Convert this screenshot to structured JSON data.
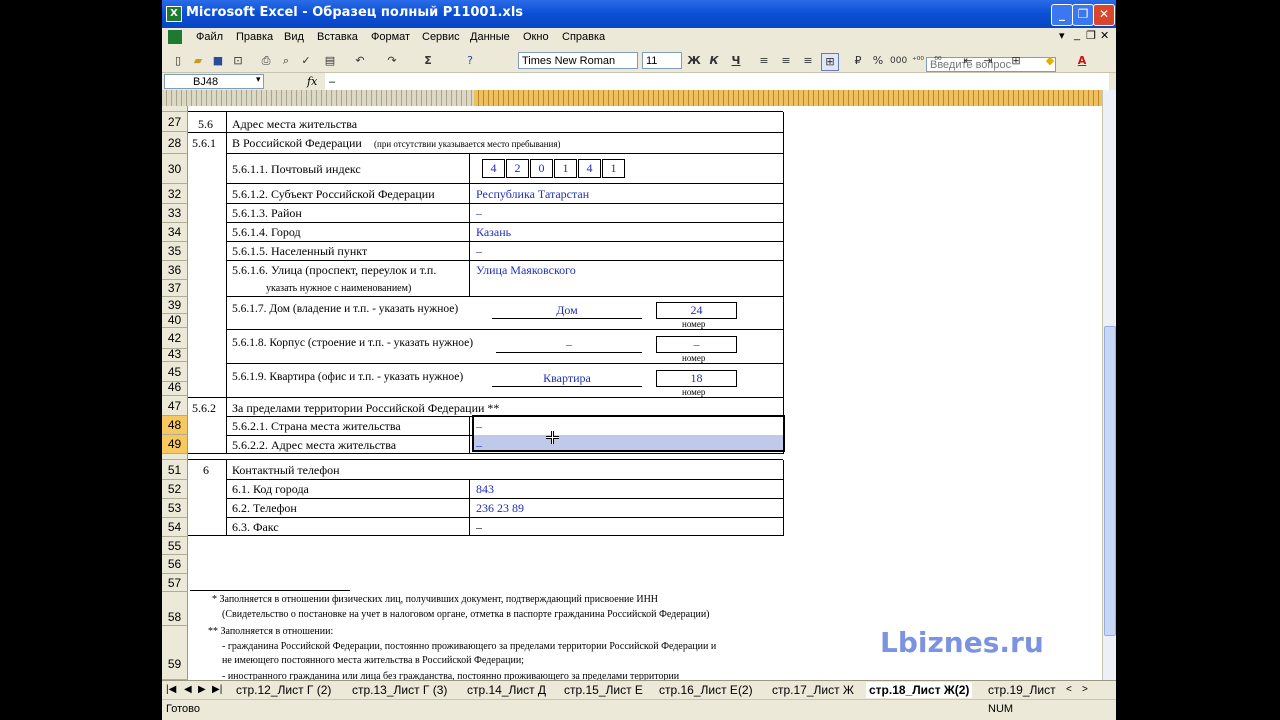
{
  "window": {
    "title": "Microsoft Excel - Образец полный Р11001.xls",
    "minimize": "_",
    "restore": "❐",
    "close": "✕"
  },
  "menu": [
    "Файл",
    "Правка",
    "Вид",
    "Вставка",
    "Формат",
    "Сервис",
    "Данные",
    "Окно",
    "Справка"
  ],
  "ask_placeholder": "Введите вопрос",
  "toolbar": {
    "font_name": "Times New Roman",
    "font_size": "11",
    "bold": "Ж",
    "italic": "К",
    "underline": "Ч",
    "sigma": "Σ",
    "percent": "%",
    "thousands": "000",
    "dec_inc": "⁺⁰⁰",
    "dec_dec": "⁰⁰",
    "font_color_letter": "A"
  },
  "formula_bar": {
    "name_box": "BJ48",
    "fx": "fx",
    "value": "–"
  },
  "rows": {
    "r27": "27",
    "r28": "28",
    "r30": "30",
    "r32": "32",
    "r33": "33",
    "r34": "34",
    "r35": "35",
    "r36": "36",
    "r37": "37",
    "r39": "39",
    "r40": "40",
    "r42": "42",
    "r43": "43",
    "r45": "45",
    "r46": "46",
    "r47": "47",
    "r48": "48",
    "r49": "49",
    "r51": "51",
    "r52": "52",
    "r53": "53",
    "r54": "54",
    "r55": "55",
    "r56": "56",
    "r57": "57",
    "r58": "58",
    "r59": "59"
  },
  "form": {
    "s56_num": "5.6",
    "s56_title": "Адрес места жительства",
    "s561_num": "5.6.1",
    "s561_title": "В Российской Федерации",
    "s561_note": "(при отсутствии указывается место пребывания)",
    "postal_label": "5.6.1.1. Почтовый индекс",
    "postal_digits": [
      "4",
      "2",
      "0",
      "1",
      "4",
      "1"
    ],
    "subject_label": "5.6.1.2. Субъект Российской Федерации",
    "subject_value": "Республика Татарстан",
    "district_label": "5.6.1.3. Район",
    "district_value": "–",
    "city_label": "5.6.1.4. Город",
    "city_value": "Казань",
    "locality_label": "5.6.1.5. Населенный пункт",
    "locality_value": "–",
    "street_label": "5.6.1.6. Улица (проспект, переулок и т.п.",
    "street_note": "указать нужное с наименованием)",
    "street_value": "Улица Маяковского",
    "house_label": "5.6.1.7. Дом (владение и т.п. - указать нужное)",
    "house_type": "Дом",
    "house_number": "24",
    "corpus_label": "5.6.1.8. Корпус (строение и т.п. - указать нужное)",
    "corpus_type": "–",
    "corpus_number": "–",
    "flat_label": "5.6.1.9. Квартира (офис и т.п. - указать нужное)",
    "flat_type": "Квартира",
    "flat_number": "18",
    "number_caption": "номер",
    "s562_num": "5.6.2",
    "s562_title": "За пределами территории Российской Федерации **",
    "country_label": "5.6.2.1. Страна места жительства",
    "country_value": "–",
    "address_label": "5.6.2.2. Адрес места жительства",
    "address_value": "–",
    "s6_num": "6",
    "s6_title": "Контактный телефон",
    "code_label": "6.1. Код города",
    "code_value": "843",
    "phone_label": "6.2. Телефон",
    "phone_value": "236 23 89",
    "fax_label": "6.3. Факс",
    "fax_value": "–"
  },
  "footnotes": {
    "f1a": "*  Заполняется   в   отношении   физических   лиц,   получивших   документ,   подтверждающий   присвоение   ИНН",
    "f1b": "(Свидетельство о постановке на учет в налоговом органе, отметка в паспорте гражданина Российской Федерации)",
    "f2a": "**  Заполняется в отношении:",
    "f2b": "- гражданина Российской Федерации, постоянно проживающего за пределами территории Российской Федерации и",
    "f2c": "не имеющего  постоянного места жительства в Российской Федерации;",
    "f2d": "-  иностранного   гражданина   или   лица   без   гражданства,   постоянно   проживающего   за   пределами   территории"
  },
  "sheet_tabs": [
    "стр.12_Лист Г (2)",
    "стр.13_Лист Г (3)",
    "стр.14_Лист Д",
    "стр.15_Лист Е",
    "стр.16_Лист Е(2)",
    "стр.17_Лист Ж",
    "стр.18_Лист Ж(2)",
    "стр.19_Лист"
  ],
  "active_tab": "стр.18_Лист Ж(2)",
  "status": {
    "ready": "Готово",
    "num": "NUM"
  },
  "watermark": "Lbiznes.ru"
}
